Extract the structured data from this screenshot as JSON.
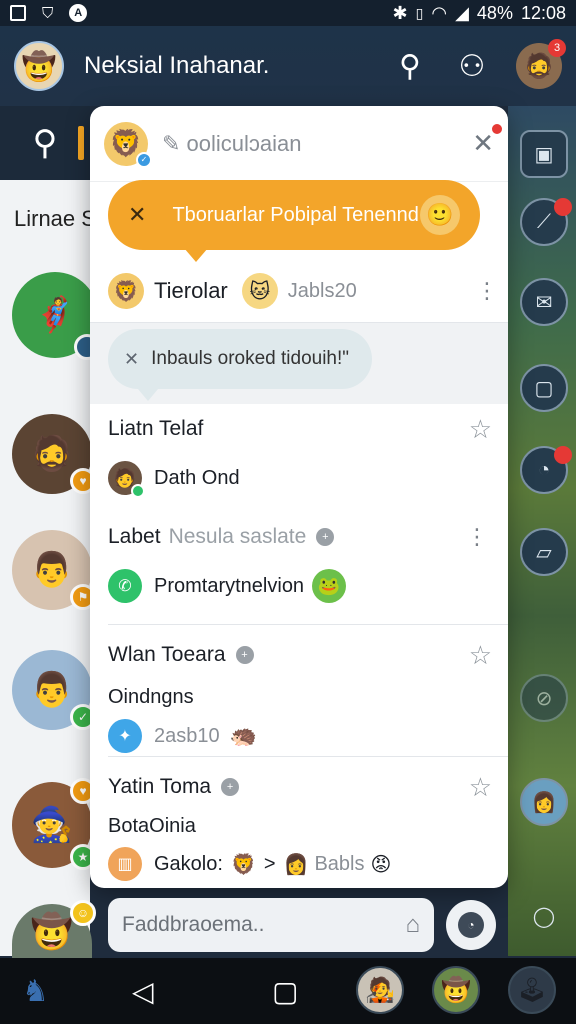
{
  "status_bar": {
    "battery": "48%",
    "time": "12:08",
    "icons": [
      "screen-record-icon",
      "shield-icon",
      "a-icon",
      "bluetooth-icon",
      "vibrate-icon",
      "wifi-icon",
      "signal-icon"
    ]
  },
  "app_bar": {
    "title": "Neksial Inahanar.",
    "search_icon": "search-icon",
    "profile_icon": "profile-icon",
    "notification_count": "3"
  },
  "left_panel": {
    "label": "Lirnae S"
  },
  "popup": {
    "header_text": "ooliculɔaian",
    "orange_bubble_text": "Tboruarlar Pobipal Tenennd",
    "tierolar_label": "Tierolar",
    "tierolar_sub": "Jabls20",
    "grey_bubble_text": "Inbauls oroked tidouih!\""
  },
  "conversations": [
    {
      "name": "Liatn Telaf",
      "extra": "",
      "message": "Dath Ond",
      "has_star": true,
      "has_info": false
    },
    {
      "name": "Labet",
      "extra": "Nesula saslate",
      "message": "Promtarytnelvion",
      "has_star": false,
      "has_info": true
    },
    {
      "name": "Wlan Toeara",
      "extra": "",
      "message": "Oindngns",
      "submessage": "2asb10",
      "has_star": true,
      "has_info": true
    },
    {
      "name": "Yatin Toma",
      "extra": "",
      "message": "BotaOinia",
      "submessage_a": "Gakolo:",
      "submessage_b": ">",
      "submessage_c": "Babls",
      "has_star": true,
      "has_info": true
    }
  ],
  "composer": {
    "placeholder": "Faddbraoema.."
  },
  "colors": {
    "accent_orange": "#f3a52a",
    "app_bar": "#1e3349",
    "badge_red": "#e53935"
  }
}
